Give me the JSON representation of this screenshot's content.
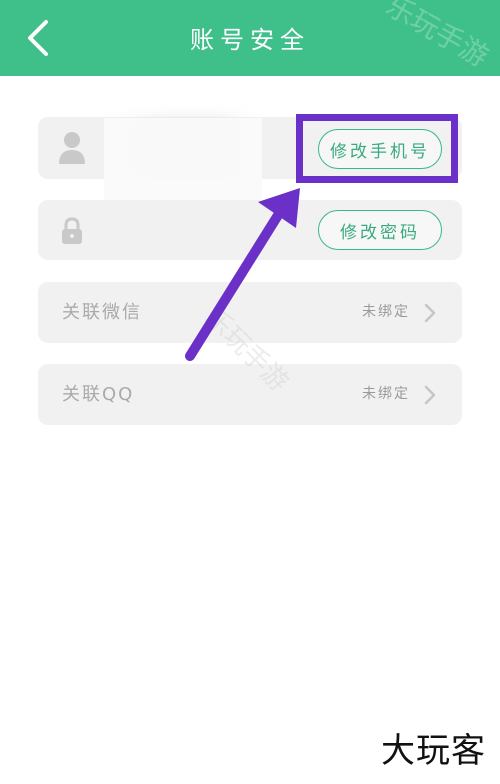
{
  "header": {
    "title": "账号安全"
  },
  "watermark": "乐玩手游",
  "phone_row": {
    "change_label": "修改手机号"
  },
  "password_row": {
    "change_label": "修改密码"
  },
  "wechat_row": {
    "label": "关联微信",
    "status": "未绑定"
  },
  "qq_row": {
    "label": "关联QQ",
    "status": "未绑定"
  },
  "brand": "大玩客",
  "colors": {
    "header": "#3fc08a",
    "accent": "#38b985",
    "annotation": "#6a30c8"
  },
  "icons": [
    "back-arrow-icon",
    "user-icon",
    "lock-icon",
    "chevron-right-icon"
  ]
}
